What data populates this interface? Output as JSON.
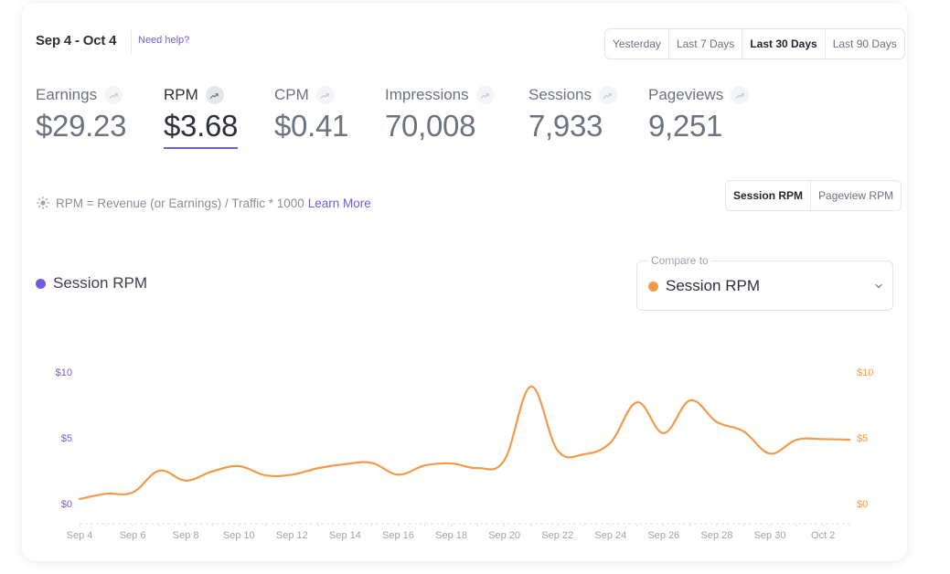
{
  "header": {
    "date_range": "Sep 4 - Oct 4",
    "help_link": "Need help?",
    "range_options": [
      {
        "label": "Yesterday",
        "active": false
      },
      {
        "label": "Last 7 Days",
        "active": false
      },
      {
        "label": "Last 30 Days",
        "active": true
      },
      {
        "label": "Last 90 Days",
        "active": false
      }
    ]
  },
  "metrics": [
    {
      "label": "Earnings",
      "value": "$29.23",
      "icon": "trend-up-icon",
      "active": false
    },
    {
      "label": "RPM",
      "value": "$3.68",
      "icon": "trend-up-icon",
      "active": true
    },
    {
      "label": "CPM",
      "value": "$0.41",
      "icon": "trend-up-icon",
      "active": false
    },
    {
      "label": "Impressions",
      "value": "70,008",
      "icon": "trend-up-icon",
      "active": false
    },
    {
      "label": "Sessions",
      "value": "7,933",
      "icon": "trend-up-icon",
      "active": false
    },
    {
      "label": "Pageviews",
      "value": "9,251",
      "icon": "trend-up-icon",
      "active": false
    }
  ],
  "formula": {
    "icon": "sun-icon",
    "text": "RPM = Revenue (or Earnings) / Traffic * 1000",
    "learn_more": "Learn More"
  },
  "rpm_toggle": [
    {
      "label": "Session RPM",
      "active": true
    },
    {
      "label": "Pageview RPM",
      "active": false
    }
  ],
  "legend": {
    "primary_label": "Session RPM",
    "compare_title": "Compare to",
    "compare_value": "Session RPM"
  },
  "colors": {
    "primary": "#6c5ce7",
    "compare": "#f2994a",
    "axis_text_gray": "#9ca3af"
  },
  "chart_data": {
    "type": "line",
    "title": "",
    "xlabel": "",
    "ylabel": "",
    "x": [
      "Sep 4",
      "Sep 5",
      "Sep 6",
      "Sep 7",
      "Sep 8",
      "Sep 9",
      "Sep 10",
      "Sep 11",
      "Sep 12",
      "Sep 13",
      "Sep 14",
      "Sep 15",
      "Sep 16",
      "Sep 17",
      "Sep 18",
      "Sep 19",
      "Sep 20",
      "Sep 21",
      "Sep 22",
      "Sep 23",
      "Sep 24",
      "Sep 25",
      "Sep 26",
      "Sep 27",
      "Sep 28",
      "Sep 29",
      "Sep 30",
      "Oct 1",
      "Oct 2",
      "Oct 3"
    ],
    "x_tick_labels": [
      "Sep 4",
      "Sep 6",
      "Sep 8",
      "Sep 10",
      "Sep 12",
      "Sep 14",
      "Sep 16",
      "Sep 18",
      "Sep 20",
      "Sep 22",
      "Sep 24",
      "Sep 26",
      "Sep 28",
      "Sep 30",
      "Oct 2"
    ],
    "ylim": [
      0,
      10
    ],
    "y_ticks_left": [
      "$0",
      "$5",
      "$10"
    ],
    "y_ticks_right": [
      "$0",
      "$5",
      "$10"
    ],
    "grid": false,
    "legend_position": "top-left",
    "series": [
      {
        "name": "Session RPM (compare)",
        "axis": "right",
        "values": [
          0.35,
          0.75,
          0.85,
          2.5,
          1.75,
          2.45,
          2.85,
          2.15,
          2.2,
          2.7,
          3.0,
          3.1,
          2.2,
          2.9,
          3.05,
          2.7,
          3.3,
          8.9,
          4.05,
          3.75,
          4.65,
          7.7,
          5.35,
          7.85,
          6.2,
          5.5,
          3.8,
          4.85,
          4.9,
          4.85
        ]
      }
    ]
  }
}
